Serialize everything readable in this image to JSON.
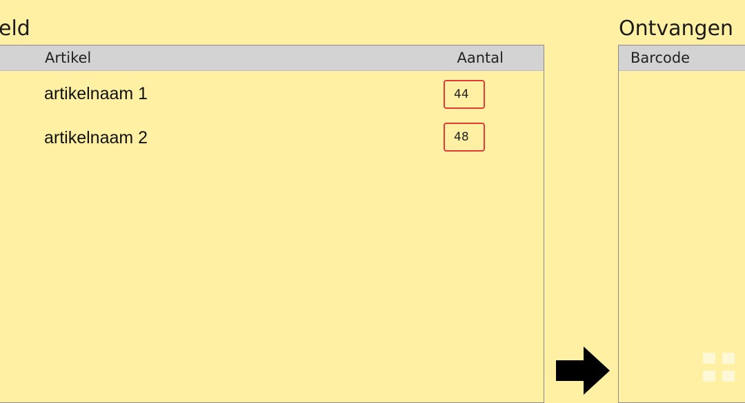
{
  "left_section": {
    "title": "eld",
    "columns": {
      "artikel": "Artikel",
      "aantal": "Aantal"
    },
    "rows": [
      {
        "artikel": "artikelnaam 1",
        "aantal": "44"
      },
      {
        "artikel": "artikelnaam 2",
        "aantal": "48"
      }
    ]
  },
  "right_section": {
    "title": "Ontvangen",
    "columns": {
      "barcode": "Barcode"
    }
  },
  "icons": {
    "transfer": "arrow-right-icon",
    "grid": "grid-icon"
  },
  "colors": {
    "background": "#FFF0A3",
    "header": "#D3D3D3",
    "highlight": "#E53935"
  }
}
